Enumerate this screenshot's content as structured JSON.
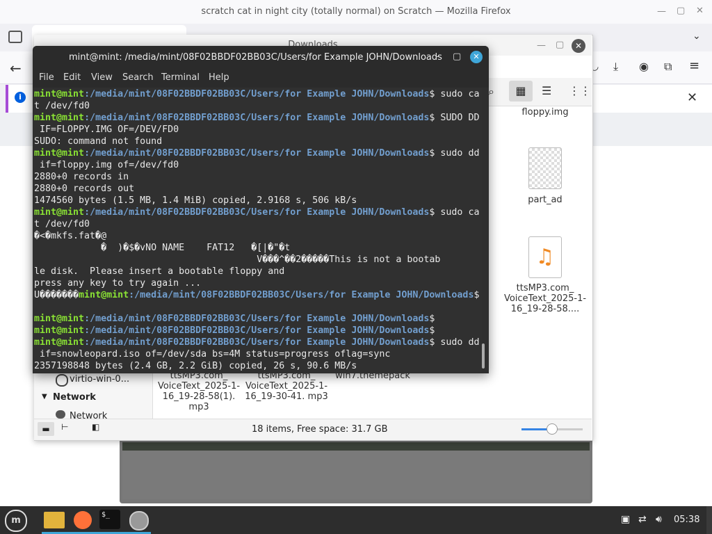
{
  "firefox": {
    "window_title": "scratch cat in night city (totally normal) on Scratch — Mozilla Firefox",
    "accent": "#a64cd6"
  },
  "nemo": {
    "title": "Downloads",
    "files": [
      {
        "name": "floppy.img",
        "icon": "disk-image-icon"
      },
      {
        "name": "part_ad",
        "icon": "generic-file-icon"
      },
      {
        "name": "ttsMP3.com_ VoiceText_2025-1-16_19-28-58....",
        "icon": "audio-file-icon"
      },
      {
        "name": "ttsMP3.com_ VoiceText_2025-1-16_19-28-58(1). mp3",
        "icon": "audio-file-icon"
      },
      {
        "name": "ttsMP3.com_ VoiceText_2025-1-16_19-30-41. mp3",
        "icon": "audio-file-icon"
      },
      {
        "name": "win7.themepack",
        "icon": "archive-icon"
      }
    ],
    "sidebar": {
      "item_virtio": "virtio-win-0...",
      "section_network": "Network",
      "item_network": "Network"
    },
    "status_text": "18 items, Free space: 31.7 GB",
    "zoom_fraction": 0.5
  },
  "terminal": {
    "title": "mint@mint: /media/mint/08F02BBDF02BB03C/Users/for Example JOHN/Downloads",
    "menu": [
      "File",
      "Edit",
      "View",
      "Search",
      "Terminal",
      "Help"
    ],
    "user": "mint@mint",
    "path": ":/media/mint/08F02BBDF02BB03C/Users/for Example JOHN/Downloads",
    "lines": [
      {
        "prompt": true,
        "cmd": "$ sudo ca"
      },
      {
        "prompt": false,
        "text": "t /dev/fd0"
      },
      {
        "prompt": true,
        "cmd": "$ SUDO DD"
      },
      {
        "prompt": false,
        "text": " IF=FLOPPY.IMG OF=/DEV/FD0"
      },
      {
        "prompt": false,
        "text": "SUDO: command not found"
      },
      {
        "prompt": true,
        "cmd": "$ sudo dd"
      },
      {
        "prompt": false,
        "text": " if=floppy.img of=/dev/fd0"
      },
      {
        "prompt": false,
        "text": "2880+0 records in"
      },
      {
        "prompt": false,
        "text": "2880+0 records out"
      },
      {
        "prompt": false,
        "text": "1474560 bytes (1.5 MB, 1.4 MiB) copied, 2.9168 s, 506 kB/s"
      },
      {
        "prompt": true,
        "cmd": "$ sudo ca"
      },
      {
        "prompt": false,
        "text": "t /dev/fd0"
      },
      {
        "prompt": false,
        "text": "�<�mkfs.fat�@"
      },
      {
        "prompt": false,
        "text": "            �  )�$�vNO NAME    FAT12   �[|�\"�t"
      },
      {
        "prompt": false,
        "text": "                                        V���^��2�����This is not a bootab"
      },
      {
        "prompt": false,
        "text": "le disk.  Please insert a bootable floppy and"
      },
      {
        "prompt": false,
        "text": "press any key to try again ..."
      },
      {
        "prompt": true,
        "lead": "U�������",
        "cmd": "$"
      },
      {
        "prompt": false,
        "text": ""
      },
      {
        "prompt": true,
        "cmd": "$"
      },
      {
        "prompt": true,
        "cmd": "$"
      },
      {
        "prompt": true,
        "cmd": "$ sudo dd"
      },
      {
        "prompt": false,
        "text": " if=snowleopard.iso of=/dev/sda bs=4M status=progress oflag=sync"
      },
      {
        "prompt": false,
        "text": "2357198848 bytes (2.4 GB, 2.2 GiB) copied, 26 s, 90.6 MB/s"
      }
    ]
  },
  "taskbar": {
    "apps": [
      "mint-menu-icon",
      "files-icon",
      "firefox-icon",
      "terminal-icon",
      "disks-icon"
    ],
    "clock": "05:38"
  }
}
